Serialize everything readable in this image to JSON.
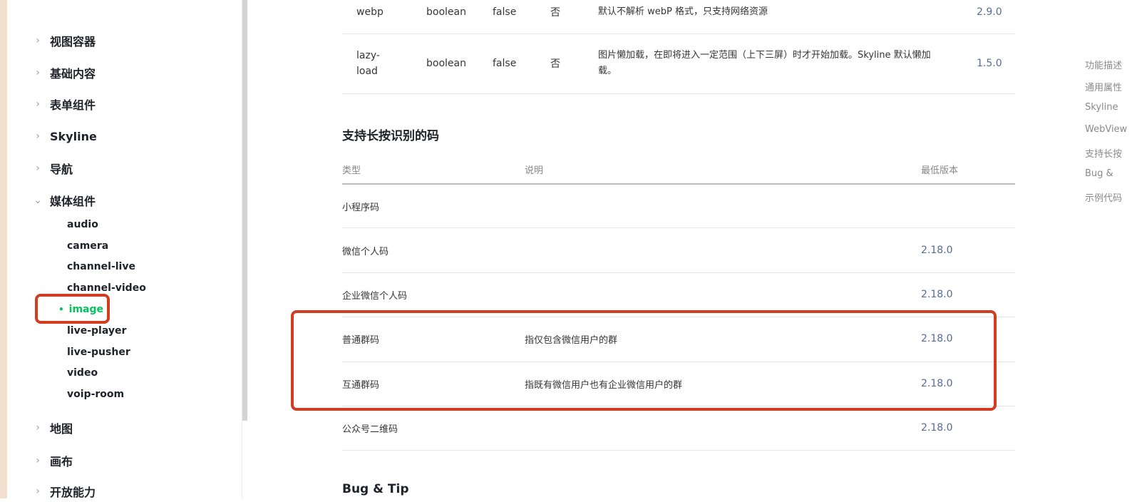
{
  "sidebar": {
    "groups": [
      {
        "label": "视图容器",
        "expanded": false
      },
      {
        "label": "基础内容",
        "expanded": false
      },
      {
        "label": "表单组件",
        "expanded": false
      },
      {
        "label": "Skyline",
        "expanded": false
      },
      {
        "label": "导航",
        "expanded": false
      },
      {
        "label": "媒体组件",
        "expanded": true
      },
      {
        "label": "地图",
        "expanded": false
      },
      {
        "label": "画布",
        "expanded": false
      },
      {
        "label": "开放能力",
        "expanded": false
      }
    ],
    "media_items": [
      "audio",
      "camera",
      "channel-live",
      "channel-video",
      "image",
      "live-player",
      "live-pusher",
      "video",
      "voip-room"
    ],
    "active_item": "image"
  },
  "props_table": {
    "rows": [
      {
        "name": "webp",
        "type": "boolean",
        "default": "false",
        "required": "否",
        "desc": "默认不解析 webP 格式，只支持网络资源",
        "version": "2.9.0"
      },
      {
        "name": "lazy-load",
        "name_line1": "lazy-",
        "name_line2": "load",
        "type": "boolean",
        "default": "false",
        "required": "否",
        "desc_line1": "图片懒加载，在即将进入一定范围（上下三屏）时才开始加载。Skyline 默认懒加",
        "desc_line2": "载。",
        "version": "1.5.0"
      }
    ]
  },
  "codes_section": {
    "title": "支持长按识别的码",
    "headers": {
      "type": "类型",
      "desc": "说明",
      "version": "最低版本"
    },
    "rows": [
      {
        "type": "小程序码",
        "desc": "",
        "version": ""
      },
      {
        "type": "微信个人码",
        "desc": "",
        "version": "2.18.0"
      },
      {
        "type": "企业微信个人码",
        "desc": "",
        "version": "2.18.0"
      },
      {
        "type": "普通群码",
        "desc": "指仅包含微信用户的群",
        "version": "2.18.0"
      },
      {
        "type": "互通群码",
        "desc": "指既有微信用户也有企业微信用户的群",
        "version": "2.18.0"
      },
      {
        "type": "公众号二维码",
        "desc": "",
        "version": "2.18.0"
      }
    ]
  },
  "next_section_title": "Bug & Tip",
  "toc": [
    "功能描述",
    "通用属性",
    "Skyline",
    "WebView",
    "支持长按",
    "Bug & ",
    "示例代码"
  ],
  "colors": {
    "accent": "#07c160",
    "highlight": "#d23c20",
    "link": "#576b95"
  }
}
